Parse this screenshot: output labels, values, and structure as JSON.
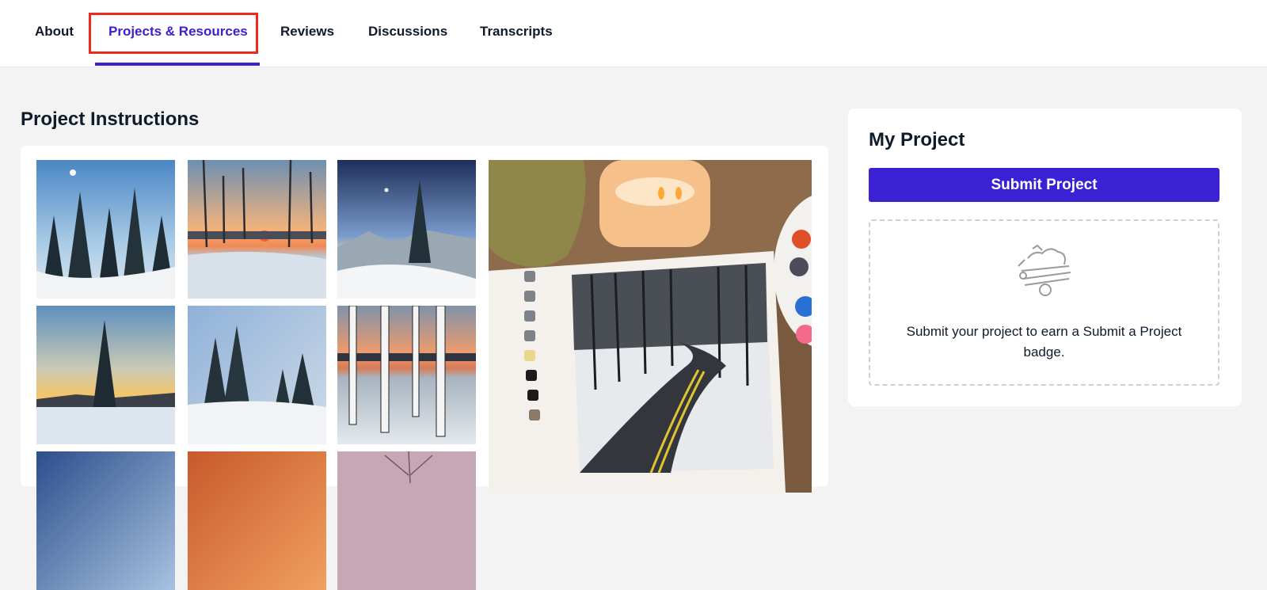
{
  "nav": {
    "tabs": [
      {
        "label": "About"
      },
      {
        "label": "Projects & Resources"
      },
      {
        "label": "Reviews"
      },
      {
        "label": "Discussions"
      },
      {
        "label": "Transcripts"
      }
    ],
    "active_tab": "Projects & Resources"
  },
  "main": {
    "title": "Project Instructions",
    "thumbnails": [
      {
        "icon": "snowy-pine-forest-moon-image"
      },
      {
        "icon": "sunset-bare-trees-image"
      },
      {
        "icon": "night-sky-pine-mountain-image"
      },
      {
        "icon": "golden-sky-lone-pine-image"
      },
      {
        "icon": "blue-sky-snow-pines-image"
      },
      {
        "icon": "birch-trees-sunset-image"
      },
      {
        "icon": "blue-evening-sky-image"
      },
      {
        "icon": "orange-sunset-sky-image"
      },
      {
        "icon": "pink-sky-bare-tree-image"
      }
    ],
    "hero": {
      "icon": "snowy-road-painting-photo"
    }
  },
  "sidebar": {
    "title": "My Project",
    "submit_label": "Submit Project",
    "badge_icon": "project-badge-icon",
    "badge_text": "Submit your project to earn a Submit a Project badge."
  },
  "colors": {
    "accent": "#3a22d4",
    "highlight": "#ea2a1c",
    "background": "#f3f3f3",
    "text": "#0e1b2b"
  }
}
